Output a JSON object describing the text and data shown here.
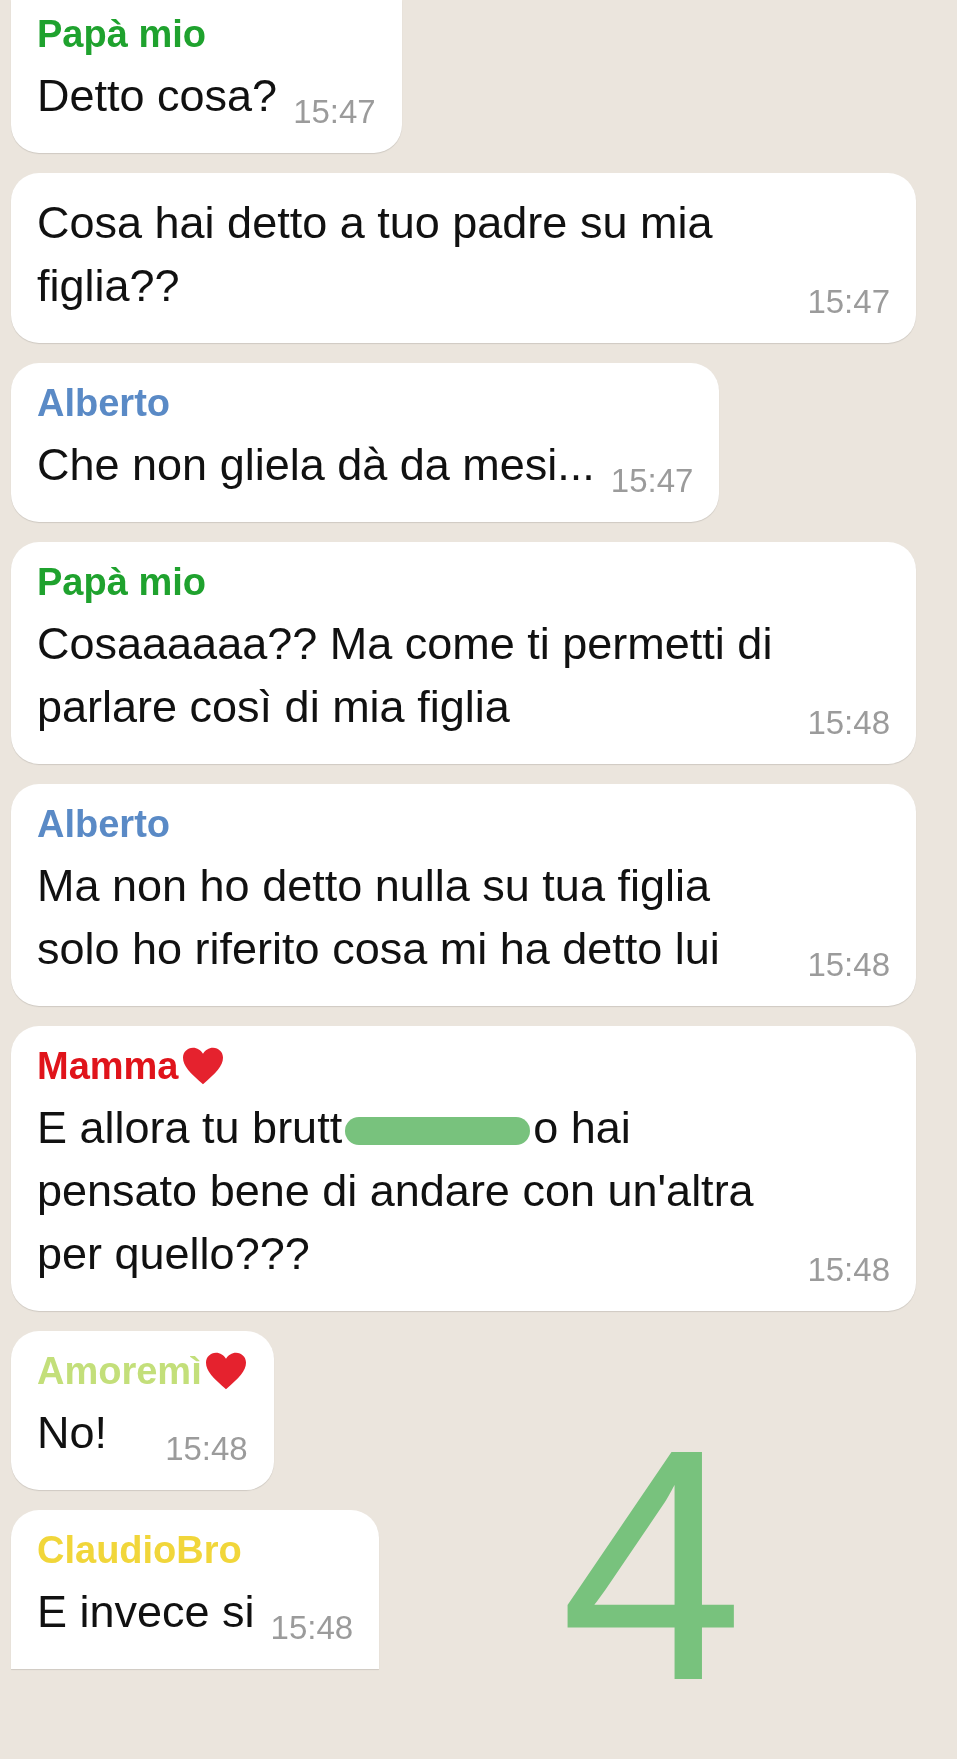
{
  "messages": [
    {
      "sender": {
        "name": "Papà mio",
        "color": "#1fa22e",
        "heart": false
      },
      "text": "Detto cosa?",
      "time": "15:47",
      "cut_top": true
    },
    {
      "text": "Cosa hai detto a tuo padre su mia figlia??",
      "time": "15:47"
    },
    {
      "sender": {
        "name": "Alberto",
        "color": "#5a8ac6",
        "heart": false
      },
      "text": "Che non gliela dà da mesi...",
      "time": "15:47"
    },
    {
      "sender": {
        "name": "Papà mio",
        "color": "#1fa22e",
        "heart": false
      },
      "text": "Cosaaaaaa?? Ma come ti permetti di parlare così di mia figlia",
      "time": "15:48"
    },
    {
      "sender": {
        "name": "Alberto",
        "color": "#5a8ac6",
        "heart": false
      },
      "text": "Ma non ho detto nulla su tua figlia solo ho riferito cosa mi ha detto lui",
      "time": "15:48"
    },
    {
      "sender": {
        "name": "Mamma",
        "color": "#e0141b",
        "heart": true
      },
      "text": "E allora tu brutt",
      "redacted": true,
      "text_after": "o hai pensato bene di andare con un'altra per quello???",
      "time": "15:48"
    },
    {
      "sender": {
        "name": "Amoremì",
        "color": "#c3df7a",
        "heart": true
      },
      "text": "No!",
      "time": "15:48"
    },
    {
      "sender": {
        "name": "ClaudioBro",
        "color": "#f1d63a",
        "heart": false
      },
      "text": "E invece si",
      "time": "15:48",
      "cut_bottom": true
    }
  ],
  "annotation": {
    "text": "4"
  }
}
